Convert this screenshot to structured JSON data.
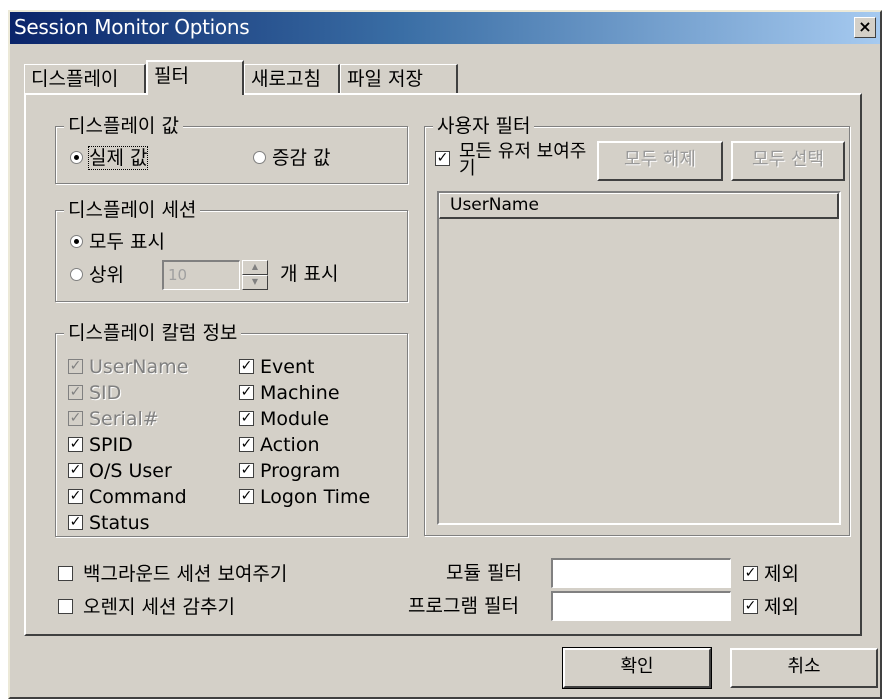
{
  "window": {
    "title": "Session Monitor Options",
    "close_glyph": "×"
  },
  "tabs": [
    "디스플레이",
    "필터",
    "새로고침",
    "파일 저장"
  ],
  "display_value": {
    "title": "디스플레이 값",
    "options": [
      "실제 값",
      "증감 값"
    ]
  },
  "display_session": {
    "title": "디스플레이 세션",
    "show_all": "모두 표시",
    "top_prefix": "상위",
    "top_value": "10",
    "top_suffix": "개 표시"
  },
  "columns": {
    "title": "디스플레이 칼럼 정보",
    "left": [
      {
        "label": "UserName",
        "checked": true,
        "disabled": true
      },
      {
        "label": "SID",
        "checked": true,
        "disabled": true
      },
      {
        "label": "Serial#",
        "checked": true,
        "disabled": true
      },
      {
        "label": "SPID",
        "checked": true,
        "disabled": false
      },
      {
        "label": "O/S User",
        "checked": true,
        "disabled": false
      },
      {
        "label": "Command",
        "checked": true,
        "disabled": false
      },
      {
        "label": "Status",
        "checked": true,
        "disabled": false
      }
    ],
    "right": [
      {
        "label": "Event",
        "checked": true
      },
      {
        "label": "Machine",
        "checked": true
      },
      {
        "label": "Module",
        "checked": true
      },
      {
        "label": "Action",
        "checked": true
      },
      {
        "label": "Program",
        "checked": true
      },
      {
        "label": "Logon Time",
        "checked": true
      }
    ]
  },
  "user_filter": {
    "title": "사용자 필터",
    "show_all_users": "모든 유저 보여주기",
    "deselect_all": "모두 해제",
    "select_all": "모두 선택",
    "list_header": "UserName"
  },
  "bottom": {
    "show_background": "백그라운드 세션 보여주기",
    "hide_orange": "오렌지 세션 감추기",
    "module_filter_label": "모듈 필터",
    "program_filter_label": "프로그램 필터",
    "exclude_label": "제외"
  },
  "footer": {
    "ok": "확인",
    "cancel": "취소"
  }
}
